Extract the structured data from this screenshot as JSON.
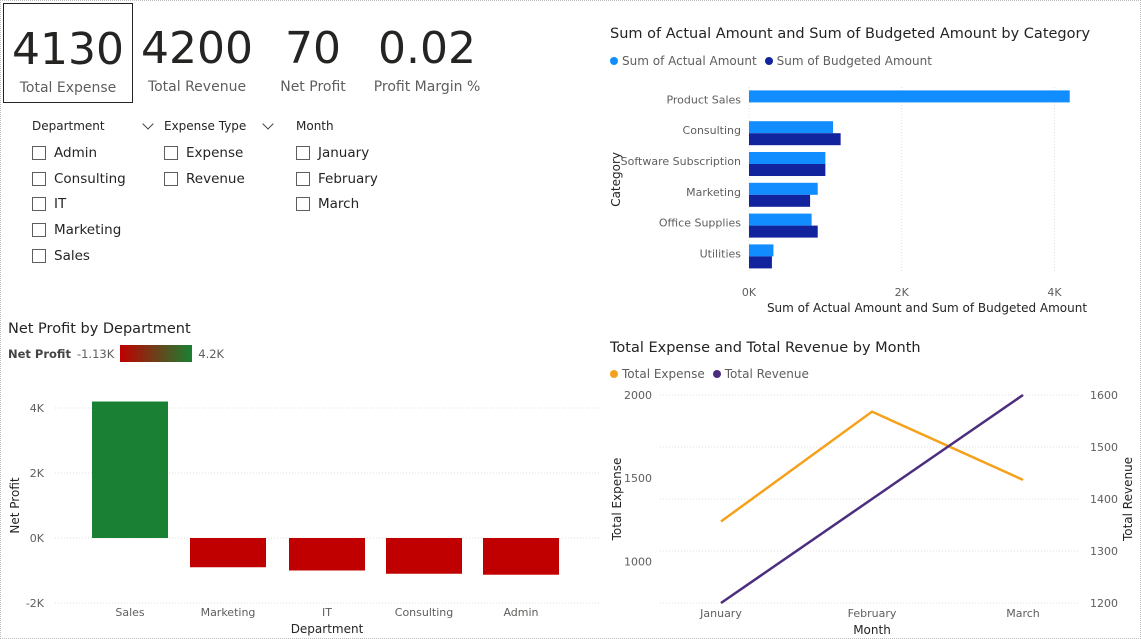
{
  "kpis": [
    {
      "value": "4130",
      "label": "Total Expense"
    },
    {
      "value": "4200",
      "label": "Total Revenue"
    },
    {
      "value": "70",
      "label": "Net Profit"
    },
    {
      "value": "0.02",
      "label": "Profit Margin %"
    }
  ],
  "slicers": {
    "department": {
      "title": "Department",
      "items": [
        "Admin",
        "Consulting",
        "IT",
        "Marketing",
        "Sales"
      ]
    },
    "expense_type": {
      "title": "Expense Type",
      "items": [
        "Expense",
        "Revenue"
      ]
    },
    "month": {
      "title": "Month",
      "items": [
        "January",
        "February",
        "March"
      ]
    }
  },
  "colors": {
    "actual": "#118dff",
    "budgeted": "#12239e",
    "orange": "#f5a11b",
    "purple": "#4c2d7e",
    "positive": "#1a8033",
    "negative": "#c00000",
    "grid": "#e1dfdd",
    "axis_text": "#605e5c"
  },
  "chart_data": [
    {
      "id": "category_bar",
      "type": "bar",
      "orientation": "horizontal",
      "title": "Sum of Actual Amount and Sum of Budgeted Amount by Category",
      "xlabel": "Sum of Actual Amount and Sum of Budgeted Amount",
      "ylabel": "Category",
      "categories": [
        "Product Sales",
        "Consulting",
        "Software Subscription",
        "Marketing",
        "Office Supplies",
        "Utilities"
      ],
      "series": [
        {
          "name": "Sum of Actual Amount",
          "values": [
            4200,
            1100,
            1000,
            900,
            820,
            320
          ]
        },
        {
          "name": "Sum of Budgeted Amount",
          "values": [
            0,
            1200,
            1000,
            800,
            900,
            300
          ]
        }
      ],
      "xlim": [
        0,
        4400
      ],
      "xticks": [
        {
          "v": 0,
          "label": "0K"
        },
        {
          "v": 2000,
          "label": "2K"
        },
        {
          "v": 4000,
          "label": "4K"
        }
      ],
      "legend": "top-left"
    },
    {
      "id": "net_profit_bar",
      "type": "bar",
      "title": "Net Profit by Department",
      "xlabel": "Department",
      "ylabel": "Net Profit",
      "categories": [
        "Sales",
        "Marketing",
        "IT",
        "Consulting",
        "Admin"
      ],
      "values": [
        4200,
        -900,
        -1000,
        -1100,
        -1130
      ],
      "ylim": [
        -2000,
        4200
      ],
      "yticks": [
        {
          "v": 4000,
          "label": "4K"
        },
        {
          "v": 2000,
          "label": "2K"
        },
        {
          "v": 0,
          "label": "0K"
        },
        {
          "v": -2000,
          "label": "-2K"
        }
      ],
      "gradient_legend": {
        "title": "Net Profit",
        "min_label": "-1.13K",
        "max_label": "4.2K"
      }
    },
    {
      "id": "month_line",
      "type": "line",
      "title": "Total Expense and Total Revenue by Month",
      "xlabel": "Month",
      "ylabel": "Total Expense",
      "ylabel_right": "Total Revenue",
      "categories": [
        "January",
        "February",
        "March"
      ],
      "series": [
        {
          "name": "Total Expense",
          "axis": "left",
          "values": [
            1240,
            1900,
            1490
          ]
        },
        {
          "name": "Total Revenue",
          "axis": "right",
          "values": [
            1200,
            1400,
            1600
          ]
        }
      ],
      "ylim": [
        750,
        2000
      ],
      "yticks": [
        {
          "v": 2000,
          "label": "2000"
        },
        {
          "v": 1500,
          "label": "1500"
        },
        {
          "v": 1000,
          "label": "1000"
        }
      ],
      "ylim_right": [
        1200,
        1600
      ],
      "yticks_right": [
        {
          "v": 1600,
          "label": "1600"
        },
        {
          "v": 1500,
          "label": "1500"
        },
        {
          "v": 1400,
          "label": "1400"
        },
        {
          "v": 1300,
          "label": "1300"
        },
        {
          "v": 1200,
          "label": "1200"
        }
      ],
      "legend": "top-left"
    }
  ]
}
